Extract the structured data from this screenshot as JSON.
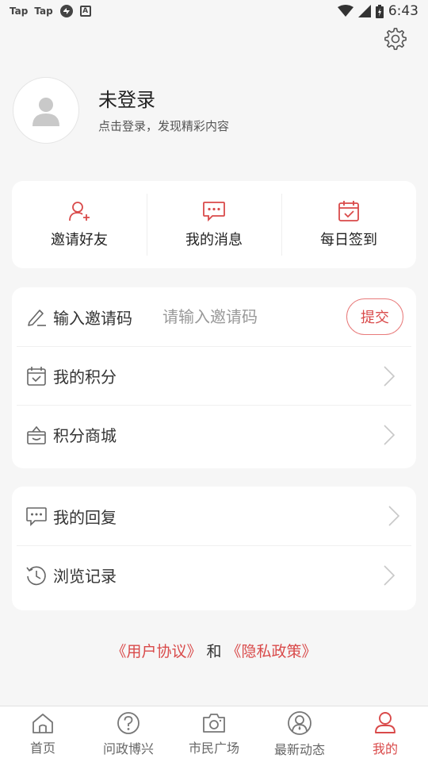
{
  "status_bar": {
    "left_items": [
      "Tap",
      "Tap"
    ],
    "time": "6:43"
  },
  "profile": {
    "name": "未登录",
    "subtitle": "点击登录，发现精彩内容"
  },
  "quick_actions": [
    {
      "label": "邀请好友",
      "icon": "invite-friend-icon"
    },
    {
      "label": "我的消息",
      "icon": "message-icon"
    },
    {
      "label": "每日签到",
      "icon": "calendar-check-icon"
    }
  ],
  "invite": {
    "label": "输入邀请码",
    "placeholder": "请输入邀请码",
    "submit_label": "提交"
  },
  "menu_group_1": [
    {
      "label": "我的积分",
      "icon": "calendar-points-icon"
    },
    {
      "label": "积分商城",
      "icon": "gift-box-icon"
    }
  ],
  "menu_group_2": [
    {
      "label": "我的回复",
      "icon": "reply-bubble-icon"
    },
    {
      "label": "浏览记录",
      "icon": "history-clock-icon"
    }
  ],
  "agreement": {
    "user_agreement": "《用户协议》",
    "and": "和",
    "privacy_policy": "《隐私政策》"
  },
  "bottom_nav": [
    {
      "label": "首页",
      "icon": "home-icon"
    },
    {
      "label": "问政博兴",
      "icon": "question-icon"
    },
    {
      "label": "市民广场",
      "icon": "camera-icon"
    },
    {
      "label": "最新动态",
      "icon": "news-person-icon"
    },
    {
      "label": "我的",
      "icon": "user-icon",
      "active": true
    }
  ],
  "colors": {
    "accent": "#d94a4a",
    "background": "#f6f6f6",
    "card": "#ffffff"
  }
}
